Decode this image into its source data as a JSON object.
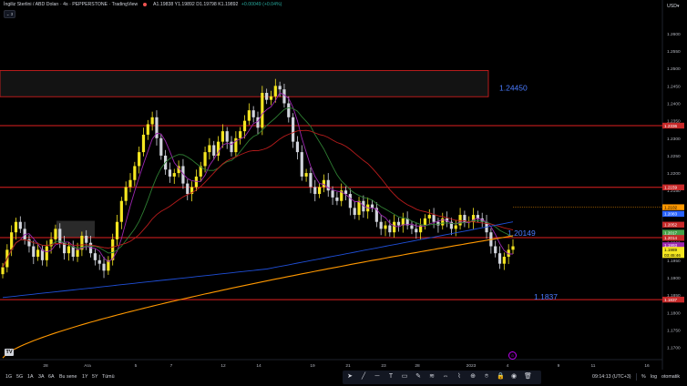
{
  "header": {
    "title": "İngiliz Sterlini / ABD Doları · 4s · PEPPERSTONE · TradingView",
    "ohlc": "A1.19838 Y1.19892 D1.19798 K1.19892",
    "change": "+0.00049 (+0.04%)"
  },
  "currency": "USD▾",
  "colors": {
    "up": "#f5e620",
    "down": "#d1d4dc",
    "zone_line": "#e02020",
    "label_blue": "#4a7bff",
    "ma_fast": "#9c27b0",
    "ma_green": "#2e7d32",
    "ma_red": "#b71c1c",
    "ma_blue": "#1f4fd8",
    "ma_orange": "#ff9800"
  },
  "chart_data": {
    "type": "candlestick",
    "symbol": "GBPUSD",
    "timeframe": "4s",
    "ylim": [
      1.1665,
      1.2665
    ],
    "y_ticks": [
      1.26,
      1.255,
      1.25,
      1.245,
      1.24,
      1.235,
      1.23,
      1.225,
      1.22,
      1.215,
      1.21,
      1.205,
      1.2,
      1.195,
      1.19,
      1.185,
      1.18,
      1.175,
      1.17
    ],
    "x_ticks": [
      "28",
      "Ara",
      "5",
      "7",
      "12",
      "14",
      "19",
      "21",
      "23",
      "28",
      "2023",
      "4",
      "9",
      "11",
      "16"
    ],
    "level_lines": [
      1.2336,
      1.2159,
      1.2015,
      1.1837
    ],
    "supply_zone": [
      1.2419,
      1.2494
    ],
    "annotations": [
      "1.24450",
      "1.20149",
      "1.1837"
    ],
    "price_badges": [
      {
        "label": "1.2336",
        "color": "#c62828"
      },
      {
        "label": "1.2159",
        "color": "#c62828"
      },
      {
        "label": "1.2102",
        "color": "#ff9800"
      },
      {
        "label": "1.2083",
        "color": "#2962ff"
      },
      {
        "label": "1.2052",
        "color": "#c62828"
      },
      {
        "label": "1.2017",
        "color": "#43a047"
      },
      {
        "label": "1.2014",
        "color": "#c62828"
      },
      {
        "label": "1.1993",
        "color": "#9c27b0"
      },
      {
        "label": "1.1989",
        "color": "#f5e620"
      },
      {
        "label": "03:45:46",
        "color": "#f5e620"
      },
      {
        "label": "1.1837",
        "color": "#c62828"
      }
    ],
    "series_close": [
      1.193,
      1.198,
      1.203,
      1.206,
      1.204,
      1.201,
      1.199,
      1.196,
      1.198,
      1.195,
      1.199,
      1.201,
      1.204,
      1.2,
      1.197,
      1.199,
      1.196,
      1.198,
      1.202,
      1.2,
      1.197,
      1.195,
      1.194,
      1.192,
      1.195,
      1.201,
      1.206,
      1.212,
      1.216,
      1.218,
      1.222,
      1.226,
      1.231,
      1.234,
      1.236,
      1.23,
      1.225,
      1.221,
      1.219,
      1.22,
      1.222,
      1.217,
      1.214,
      1.216,
      1.219,
      1.222,
      1.226,
      1.228,
      1.225,
      1.229,
      1.232,
      1.229,
      1.226,
      1.23,
      1.232,
      1.235,
      1.238,
      1.236,
      1.233,
      1.243,
      1.241,
      1.242,
      1.245,
      1.244,
      1.24,
      1.236,
      1.229,
      1.226,
      1.219,
      1.22,
      1.216,
      1.214,
      1.216,
      1.218,
      1.215,
      1.213,
      1.212,
      1.215,
      1.214,
      1.21,
      1.208,
      1.212,
      1.209,
      1.211,
      1.21,
      1.206,
      1.204,
      1.205,
      1.203,
      1.206,
      1.205,
      1.207,
      1.205,
      1.204,
      1.203,
      1.205,
      1.207,
      1.208,
      1.206,
      1.205,
      1.207,
      1.206,
      1.204,
      1.205,
      1.208,
      1.206,
      1.206,
      1.208,
      1.207,
      1.206,
      1.203,
      1.199,
      1.197,
      1.194,
      1.196,
      1.198,
      1.199
    ]
  },
  "timeframes": [
    "1G",
    "5G",
    "1A",
    "3A",
    "6A",
    "Bu sene",
    "1Y",
    "5Y",
    "Tümü"
  ],
  "toolbar_icons": [
    "cursor-icon",
    "trendline-icon",
    "horizontal-line-icon",
    "text-icon",
    "rectangle-icon",
    "brush-icon",
    "fib-icon",
    "measure-icon",
    "pattern-icon",
    "zoom-icon",
    "magnet-icon",
    "lock-icon",
    "eye-icon",
    "trash-icon"
  ],
  "status": {
    "clock": "09:14:13 (UTC+3)",
    "pct": "%",
    "log": "log",
    "auto": "otomatik"
  },
  "collapse": "⌄ 3"
}
